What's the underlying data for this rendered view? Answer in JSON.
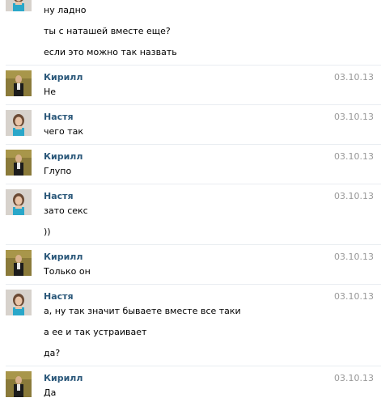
{
  "colors": {
    "name": "#2b587a",
    "date": "#999999",
    "text": "#000000"
  },
  "messages": [
    {
      "lines": [
        "ну ладно",
        "ты с наташей вместе еще?",
        "если это можно так назвать"
      ]
    },
    {
      "author": "Кирилл",
      "date": "03.10.13",
      "lines": [
        "Не"
      ]
    },
    {
      "author": "Настя",
      "date": "03.10.13",
      "lines": [
        "чего так"
      ]
    },
    {
      "author": "Кирилл",
      "date": "03.10.13",
      "lines": [
        "Глупо"
      ]
    },
    {
      "author": "Настя",
      "date": "03.10.13",
      "lines": [
        "зато секс",
        "))"
      ]
    },
    {
      "author": "Кирилл",
      "date": "03.10.13",
      "lines": [
        "Только он"
      ]
    },
    {
      "author": "Настя",
      "date": "03.10.13",
      "lines": [
        "а, ну так значит бываете вместе все таки",
        "а ее и так устраивает",
        "да?"
      ]
    },
    {
      "author": "Кирилл",
      "date": "03.10.13",
      "lines": [
        "Да"
      ]
    }
  ],
  "avatars": {
    "kirill": "avatar-kirill",
    "nastya": "avatar-nastya"
  }
}
